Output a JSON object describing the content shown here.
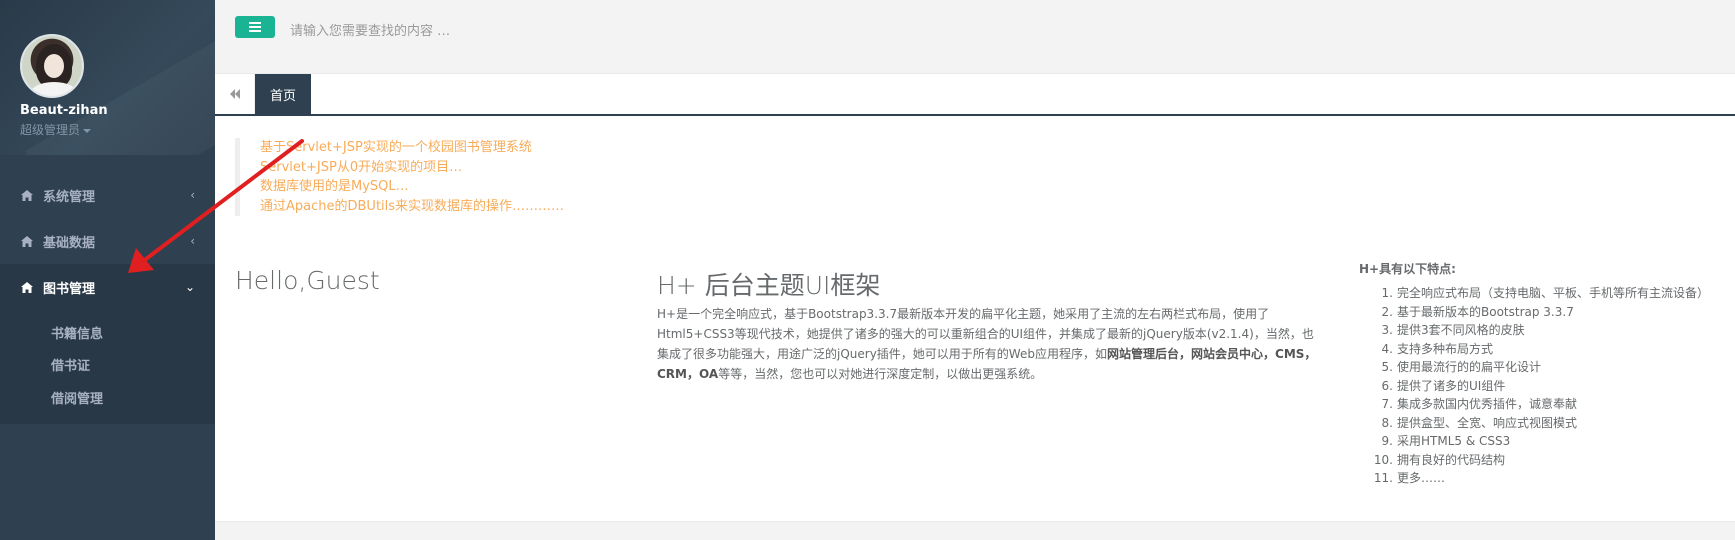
{
  "sidebar": {
    "profile": {
      "name": "Beaut-zihan",
      "role": "超级管理员"
    },
    "items": [
      {
        "label": "系统管理",
        "icon": "home-icon",
        "expanded": false
      },
      {
        "label": "基础数据",
        "icon": "home-icon",
        "expanded": false
      },
      {
        "label": "图书管理",
        "icon": "home-icon",
        "expanded": true,
        "children": [
          "书籍信息",
          "借书证",
          "借阅管理"
        ]
      }
    ]
  },
  "topbar": {
    "search_placeholder": "请输入您需要查找的内容 …",
    "menu_color": "#1ab394"
  },
  "tabs": {
    "items": [
      "首页"
    ]
  },
  "content": {
    "quote_lines": [
      "基于Servlet+JSP实现的一个校园图书管理系统",
      "Servlet+JSP从0开始实现的项目…",
      "数据库使用的是MySQL…",
      "通过Apache的DBUtils来实现数据库的操作…………"
    ],
    "hello": "Hello,Guest",
    "hplus": {
      "title": "H+ 后台主题UI框架",
      "desc_part1": "H+是一个完全响应式，基于Bootstrap3.3.7最新版本开发的扁平化主题，她采用了主流的左右两栏式布局，使用了Html5+CSS3等现代技术，她提供了诸多的强大的可以重新组合的UI组件，并集成了最新的jQuery版本(v2.1.4)，当然，也集成了很多功能强大，用途广泛的jQuery插件，她可以用于所有的Web应用程序，如",
      "desc_bold1": "网站管理后台",
      "desc_sep1": "，",
      "desc_bold2": "网站会员中心",
      "desc_sep2": "，",
      "desc_bold3": "CMS",
      "desc_sep3": "，",
      "desc_bold4": "CRM",
      "desc_sep4": "，",
      "desc_bold5": "OA",
      "desc_part2": "等等，当然，您也可以对她进行深度定制，以做出更强系统。"
    },
    "features_title": "H+具有以下特点:",
    "features": [
      "完全响应式布局（支持电脑、平板、手机等所有主流设备）",
      "基于最新版本的Bootstrap 3.3.7",
      "提供3套不同风格的皮肤",
      "支持多种布局方式",
      "使用最流行的的扁平化设计",
      "提供了诸多的UI组件",
      "集成多款国内优秀插件，诚意奉献",
      "提供盒型、全宽、响应式视图模式",
      "采用HTML5 & CSS3",
      "拥有良好的代码结构",
      "更多……"
    ]
  },
  "colors": {
    "sidebar_bg": "#2f4050",
    "quote": "#f8ac59",
    "annotation_arrow": "#e02020"
  }
}
